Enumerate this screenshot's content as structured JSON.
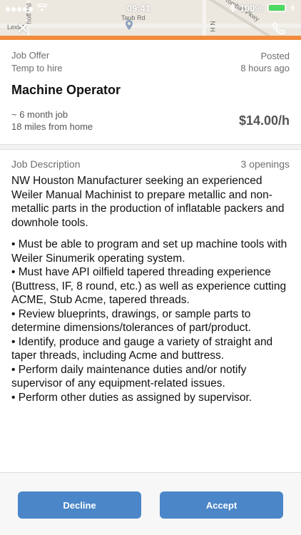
{
  "status_bar": {
    "time": "09:41",
    "battery": "100%"
  },
  "map": {
    "labels": [
      "Taub Rd",
      "Tomball Pkwy",
      "Lexial",
      "hoff Rd",
      "N H"
    ]
  },
  "offer": {
    "label": "Job Offer",
    "type": "Temp to hire",
    "posted_label": "Posted",
    "posted_time": "8 hours ago",
    "title": "Machine Operator",
    "duration": "~ 6 month job",
    "distance": "18 miles from home",
    "pay": "$14.00/h"
  },
  "description": {
    "heading": "Job Description",
    "openings": "3 openings",
    "intro": "NW Houston Manufacturer seeking an experienced Weiler Manual Machinist to prepare metallic and non-metallic parts in the production of inflatable packers and downhole tools.",
    "bullets": [
      "• Must be able to program and set up machine tools with Weiler Sinumerik operating system.",
      "• Must have API oilfield tapered threading experience (Buttress, IF, 8 round, etc.) as well as experience cutting ACME, Stub Acme, tapered threads.",
      "• Review blueprints, drawings, or sample parts to determine dimensions/tolerances of part/product.",
      "• Identify, produce and gauge a variety of straight and taper threads, including Acme and buttress.",
      "• Perform daily maintenance duties and/or notify supervisor of any equipment-related issues.",
      "• Perform other duties as assigned by supervisor."
    ]
  },
  "actions": {
    "decline": "Decline",
    "accept": "Accept"
  },
  "colors": {
    "accent_orange": "#f28c3c",
    "button_blue": "#4a86c8",
    "battery_green": "#4cd964"
  },
  "icons": [
    "close-icon",
    "phone-icon",
    "map-pin-icon",
    "wifi-icon",
    "bluetooth-icon",
    "battery-icon",
    "charging-icon"
  ]
}
